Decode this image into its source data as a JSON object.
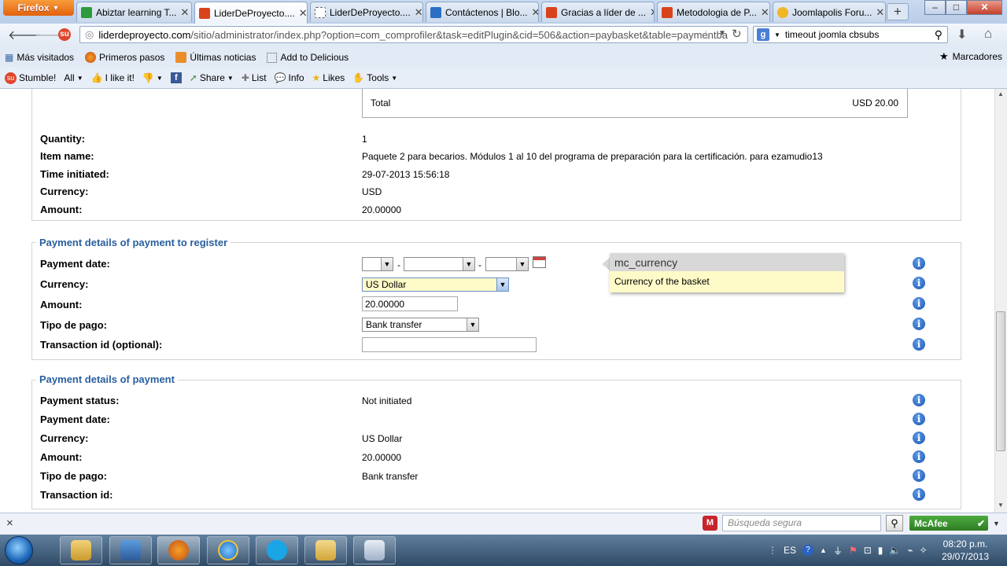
{
  "browser": {
    "menu_label": "Firefox",
    "tabs": [
      {
        "label": "Abiztar learning T...",
        "color": "#2c9b3c"
      },
      {
        "label": "LiderDeProyecto....",
        "color": "#d9431c",
        "active": true
      },
      {
        "label": "LiderDeProyecto....",
        "color": "#ffffff"
      },
      {
        "label": "Contáctenos | Blo...",
        "color": "#2a6fc4"
      },
      {
        "label": "Gracias a líder de ...",
        "color": "#d9431c"
      },
      {
        "label": "Metodologia de P...",
        "color": "#d9431c"
      },
      {
        "label": "Joomlapolis Foru...",
        "color": "#f0b627"
      }
    ],
    "newtab_label": "+",
    "window_buttons": {
      "min": "–",
      "max": "□",
      "close": "✕"
    },
    "url_domain": "liderdeproyecto.com",
    "url_path": "/sitio/administrator/index.php?option=com_comprofiler&task=editPlugin&cid=506&action=paybasket&table=paymentba",
    "search_value": "timeout joomla cbsubs",
    "bookmarks": [
      "Más visitados",
      "Primeros pasos",
      "Últimas noticias",
      "Add to Delicious"
    ],
    "bookmarks_menu": "Marcadores",
    "stumble": {
      "stumble": "Stumble!",
      "all": "All",
      "ilike": "I like it!",
      "share": "Share",
      "list": "List",
      "info": "Info",
      "likes": "Likes",
      "tools": "Tools"
    }
  },
  "basket": {
    "total_label": "Total",
    "total_value": "USD 20.00",
    "rows": [
      {
        "label": "Quantity:",
        "value": "1"
      },
      {
        "label": "Item name:",
        "value": "Paquete 2 para becarios. Módulos 1 al 10 del programa de preparación para la certificación. para ezamudio13"
      },
      {
        "label": "Time initiated:",
        "value": "29-07-2013 15:56:18"
      },
      {
        "label": "Currency:",
        "value": "USD"
      },
      {
        "label": "Amount:",
        "value": "20.00000"
      }
    ]
  },
  "register": {
    "legend": "Payment details of payment to register",
    "date_label": "Payment date:",
    "date_sep": "-",
    "currency_label": "Currency:",
    "currency_value": "US Dollar",
    "amount_label": "Amount:",
    "amount_value": "20.00000",
    "type_label": "Tipo de pago:",
    "type_value": "Bank transfer",
    "txn_label": "Transaction id (optional):",
    "txn_value": ""
  },
  "tooltip": {
    "title": "mc_currency",
    "body": "Currency of the basket"
  },
  "payment": {
    "legend": "Payment details of payment",
    "rows": [
      {
        "label": "Payment status:",
        "value": "Not initiated"
      },
      {
        "label": "Payment date:",
        "value": ""
      },
      {
        "label": "Currency:",
        "value": "US Dollar"
      },
      {
        "label": "Amount:",
        "value": "20.00000"
      },
      {
        "label": "Tipo de pago:",
        "value": "Bank transfer"
      },
      {
        "label": "Transaction id:",
        "value": ""
      }
    ]
  },
  "findbar": {
    "close": "×",
    "secure_search_placeholder": "Búsqueda segura",
    "mcafee": "McAfee"
  },
  "taskbar": {
    "lang": "ES",
    "time": "08:20 p.m.",
    "date": "29/07/2013"
  }
}
